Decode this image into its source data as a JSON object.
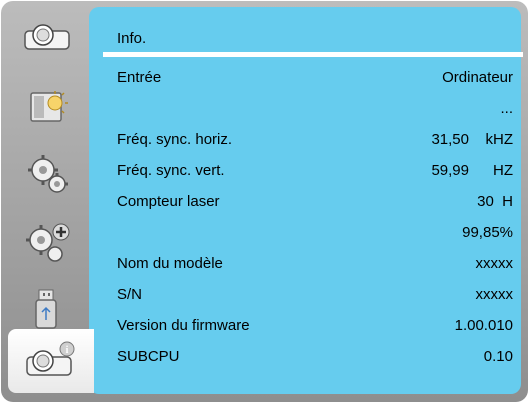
{
  "menu": {
    "title": "Info.",
    "rows": [
      {
        "label": "Entrée",
        "value": "Ordinateur"
      },
      {
        "label": "",
        "value": "..."
      },
      {
        "label": "Fréq. sync. horiz.",
        "number": "31,50",
        "unit": "kHZ"
      },
      {
        "label": "Fréq. sync. vert.",
        "number": "59,99",
        "unit": "HZ"
      },
      {
        "label": "Compteur laser",
        "value": "30  H"
      },
      {
        "label": "",
        "value": "99,85%"
      },
      {
        "label": "Nom du modèle",
        "value": "xxxxx"
      },
      {
        "label": "S/N",
        "value": "xxxxx"
      },
      {
        "label": "Version du firmware",
        "value": "1.00.010"
      },
      {
        "label": "SUBCPU",
        "value": "0.10"
      }
    ]
  },
  "sidebar": {
    "items": [
      {
        "icon": "projector-icon",
        "active": false
      },
      {
        "icon": "display-brightness-icon",
        "active": false
      },
      {
        "icon": "gear-icon",
        "active": false
      },
      {
        "icon": "gear-plus-icon",
        "active": false
      },
      {
        "icon": "usb-drive-icon",
        "active": false
      },
      {
        "icon": "projector-info-icon",
        "active": true
      }
    ]
  },
  "colors": {
    "panel": "#66ccee",
    "frame": "#a9a9a9",
    "rule": "#ffffff"
  }
}
